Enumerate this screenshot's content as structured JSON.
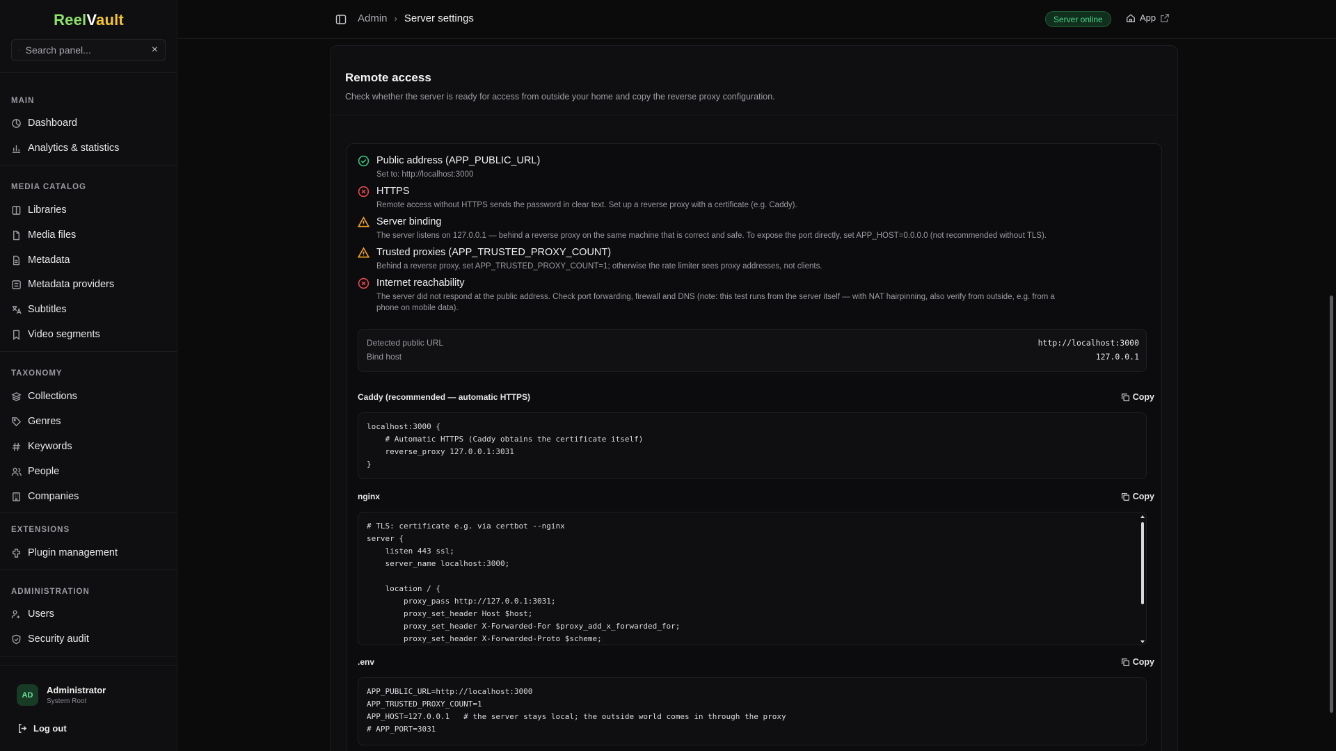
{
  "brand": {
    "part1": "Reel",
    "part2": "V",
    "part3": "ault"
  },
  "search": {
    "placeholder": "Search panel..."
  },
  "sidebar": {
    "sections": [
      {
        "title": "MAIN",
        "items": [
          {
            "label": "Dashboard",
            "icon": "dashboard-icon"
          },
          {
            "label": "Analytics & statistics",
            "icon": "bar-chart-icon"
          }
        ]
      },
      {
        "title": "MEDIA CATALOG",
        "items": [
          {
            "label": "Libraries",
            "icon": "library-icon"
          },
          {
            "label": "Media files",
            "icon": "file-icon"
          },
          {
            "label": "Metadata",
            "icon": "document-icon"
          },
          {
            "label": "Metadata providers",
            "icon": "provider-icon"
          },
          {
            "label": "Subtitles",
            "icon": "translate-icon"
          },
          {
            "label": "Video segments",
            "icon": "bookmark-icon"
          }
        ]
      },
      {
        "title": "TAXONOMY",
        "items": [
          {
            "label": "Collections",
            "icon": "layers-icon"
          },
          {
            "label": "Genres",
            "icon": "tag-icon"
          },
          {
            "label": "Keywords",
            "icon": "hash-icon"
          },
          {
            "label": "People",
            "icon": "people-icon"
          },
          {
            "label": "Companies",
            "icon": "building-icon"
          }
        ]
      },
      {
        "title": "EXTENSIONS",
        "items": [
          {
            "label": "Plugin management",
            "icon": "plugin-icon"
          }
        ]
      },
      {
        "title": "ADMINISTRATION",
        "items": [
          {
            "label": "Users",
            "icon": "users-icon"
          },
          {
            "label": "Security audit",
            "icon": "shield-icon"
          }
        ]
      }
    ],
    "user": {
      "initials": "AD",
      "name": "Administrator",
      "role": "System Root"
    },
    "logout": "Log out"
  },
  "topbar": {
    "breadcrumb": [
      "Admin",
      "Server settings"
    ],
    "status_badge": "Server online",
    "status_color": "#4fd68a",
    "app_link": "App"
  },
  "main": {
    "title": "Remote access",
    "description": "Check whether the server is ready for access from outside your home and copy the reverse proxy configuration.",
    "checks": [
      {
        "status": "ok",
        "title": "Public address (APP_PUBLIC_URL)",
        "detail": "Set to: http://localhost:3000"
      },
      {
        "status": "error",
        "title": "HTTPS",
        "detail": "Remote access without HTTPS sends the password in clear text. Set up a reverse proxy with a certificate (e.g. Caddy)."
      },
      {
        "status": "warning",
        "title": "Server binding",
        "detail": "The server listens on 127.0.0.1 — behind a reverse proxy on the same machine that is correct and safe. To expose the port directly, set APP_HOST=0.0.0.0 (not recommended without TLS)."
      },
      {
        "status": "warning",
        "title": "Trusted proxies (APP_TRUSTED_PROXY_COUNT)",
        "detail": "Behind a reverse proxy, set APP_TRUSTED_PROXY_COUNT=1; otherwise the rate limiter sees proxy addresses, not clients."
      },
      {
        "status": "error",
        "title": "Internet reachability",
        "detail": "The server did not respond at the public address. Check port forwarding, firewall and DNS (note: this test runs from the server itself — with NAT hairpinning, also verify from outside, e.g. from a",
        "detail2": "phone on mobile data)."
      }
    ],
    "status_colors": {
      "ok": "#34c47a",
      "error": "#e5484d",
      "warning": "#f5a524"
    },
    "info": {
      "public_url_label": "Detected public URL",
      "public_url_value": "http://localhost:3000",
      "bind_host_label": "Bind host",
      "bind_host_value": "127.0.0.1"
    },
    "copy_label": "Copy",
    "blocks": {
      "caddy": {
        "label": "Caddy (recommended — automatic HTTPS)",
        "code": "localhost:3000 {\n    # Automatic HTTPS (Caddy obtains the certificate itself)\n    reverse_proxy 127.0.0.1:3031\n}"
      },
      "nginx": {
        "label": "nginx",
        "code": "# TLS: certificate e.g. via certbot --nginx\nserver {\n    listen 443 ssl;\n    server_name localhost:3000;\n\n    location / {\n        proxy_pass http://127.0.0.1:3031;\n        proxy_set_header Host $host;\n        proxy_set_header X-Forwarded-For $proxy_add_x_forwarded_for;\n        proxy_set_header X-Forwarded-Proto $scheme;\n    }\n}"
      },
      "env": {
        "label": ".env",
        "code": "APP_PUBLIC_URL=http://localhost:3000\nAPP_TRUSTED_PROXY_COUNT=1\nAPP_HOST=127.0.0.1   # the server stays local; the outside world comes in through the proxy\n# APP_PORT=3031"
      }
    }
  }
}
